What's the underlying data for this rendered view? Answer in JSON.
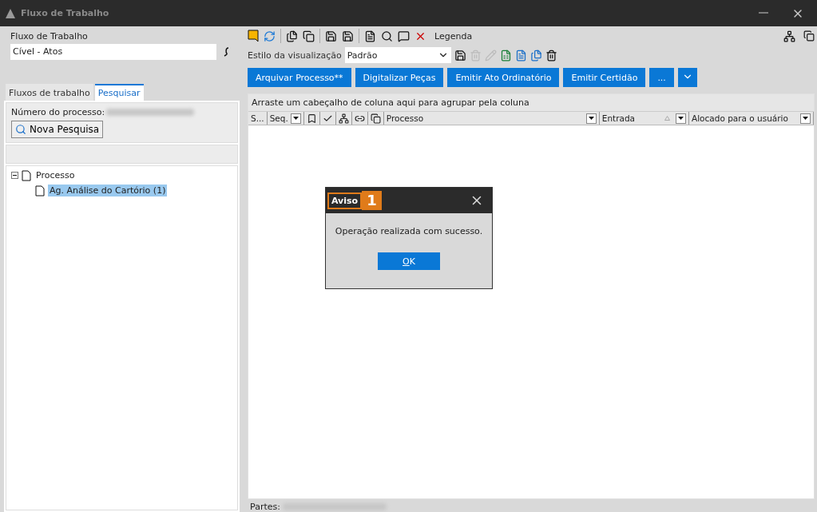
{
  "window": {
    "title": "Fluxo de Trabalho"
  },
  "left": {
    "workflow_label": "Fluxo de Trabalho",
    "workflow_value": "Cível - Atos",
    "tabs": [
      {
        "label": "Fluxos de trabalho",
        "selected": false
      },
      {
        "label": "Pesquisar",
        "selected": true
      }
    ],
    "search_label": "Número do processo:",
    "new_search_button": "Nova Pesquisa",
    "tree": [
      {
        "label": "Processo",
        "expanded": true,
        "selected": false,
        "children": [
          {
            "label": "Ag. Análise do Cartório (1)",
            "selected": true
          }
        ]
      }
    ]
  },
  "toolbar": {
    "legend": "Legenda"
  },
  "view": {
    "label": "Estilo da visualização",
    "value": "Padrão"
  },
  "actions": [
    "Arquivar Processo**",
    "Digitalizar Peças",
    "Emitir Ato Ordinatório",
    "Emitir Certidão",
    "..."
  ],
  "grid": {
    "group_hint": "Arraste um cabeçalho de coluna aqui para agrupar pela coluna",
    "columns": [
      {
        "kind": "text",
        "label": "S...",
        "filter": false,
        "sorted": false
      },
      {
        "kind": "text",
        "label": "Seq.",
        "filter": true,
        "sorted": false
      },
      {
        "kind": "icon"
      },
      {
        "kind": "icon"
      },
      {
        "kind": "icon"
      },
      {
        "kind": "icon"
      },
      {
        "kind": "icon"
      },
      {
        "kind": "text",
        "label": "Processo",
        "filter": true,
        "sorted": false
      },
      {
        "kind": "text",
        "label": "Entrada",
        "filter": true,
        "sorted": true
      },
      {
        "kind": "text",
        "label": "Alocado para o usuário",
        "filter": true,
        "sorted": false
      }
    ]
  },
  "footer": {
    "label": "Partes:"
  },
  "dialog": {
    "title": "Aviso",
    "badge": "1",
    "message": "Operação realizada com sucesso.",
    "ok": "OK"
  }
}
